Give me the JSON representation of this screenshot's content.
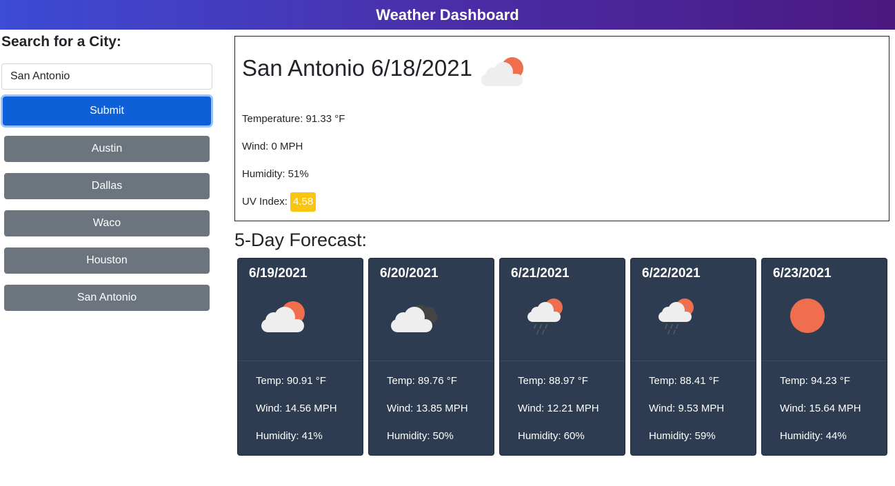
{
  "header": {
    "title": "Weather Dashboard"
  },
  "search": {
    "heading": "Search for a City:",
    "input_value": "San Antonio",
    "submit_label": "Submit"
  },
  "history": [
    "Austin",
    "Dallas",
    "Waco",
    "Houston",
    "San Antonio"
  ],
  "current": {
    "title": "San Antonio 6/18/2021",
    "icon": "partly-cloudy-icon",
    "temperature": "Temperature: 91.33 °F",
    "wind": "Wind: 0 MPH",
    "humidity": "Humidity: 51%",
    "uv_label": "UV Index:",
    "uv_value": "4.58"
  },
  "forecast": {
    "heading": "5-Day Forecast:",
    "days": [
      {
        "date": "6/19/2021",
        "icon": "partly-cloudy-icon",
        "temp": "Temp: 90.91 °F",
        "wind": "Wind: 14.56 MPH",
        "humidity": "Humidity: 41%"
      },
      {
        "date": "6/20/2021",
        "icon": "cloudy-icon",
        "temp": "Temp: 89.76 °F",
        "wind": "Wind: 13.85 MPH",
        "humidity": "Humidity: 50%"
      },
      {
        "date": "6/21/2021",
        "icon": "rain-sun-icon",
        "temp": "Temp: 88.97 °F",
        "wind": "Wind: 12.21 MPH",
        "humidity": "Humidity: 60%"
      },
      {
        "date": "6/22/2021",
        "icon": "rain-sun-icon",
        "temp": "Temp: 88.41 °F",
        "wind": "Wind: 9.53 MPH",
        "humidity": "Humidity: 59%"
      },
      {
        "date": "6/23/2021",
        "icon": "sun-icon",
        "temp": "Temp: 94.23 °F",
        "wind": "Wind: 15.64 MPH",
        "humidity": "Humidity: 44%"
      }
    ]
  },
  "colors": {
    "header_gradient_start": "#3d4bd6",
    "header_gradient_end": "#4b1880",
    "submit": "#0d60d8",
    "history_button": "#6c757d",
    "uv_badge": "#f9c513",
    "forecast_card": "#2d3c50",
    "sun": "#ee6e4d"
  }
}
